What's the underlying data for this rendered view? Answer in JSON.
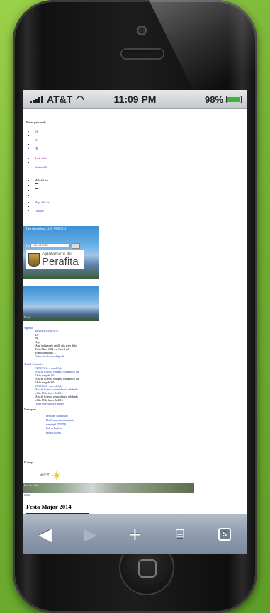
{
  "status": {
    "carrier": "AT&T",
    "time": "11:09 PM",
    "battery": "98%"
  },
  "page": {
    "title": "Eines personals",
    "lang_links": [
      "ES",
      "EN",
      "FR"
    ],
    "accessibility_link": "Accés mòbil",
    "full_view_link": "Vista mòbil",
    "size_label": "Mida del text",
    "sitemap_link": "Mapa del Lloc",
    "contact_link": "Contacte",
    "update_text": "Data i hora refresc: 22:07 / 09/08/2014",
    "search_label": "Cercar",
    "search_placeholder": "Cerca en el lloc",
    "logo_small": "Ajuntament de",
    "logo_big": "Perafita",
    "banner2_text": "Portal",
    "agenda_title": "Agenda",
    "agenda_lines": [
      "FESTA MAJOR 2014",
      "DV",
      "08",
      "Ago",
      "Aquí trobareu els detalls dels actes de la",
      "Festa Major 2014 a al Cartell del",
      "Esmorzament del ...",
      "Veure tots els actes d'agenda"
    ],
    "board_title": "Taulell d'anuncis",
    "board_lines": [
      "18/08/2014 - Actes del ple",
      "Acta de la sessió ordinària celebrada el dia",
      "18 de maig de 2014",
      "Acta de la sessió ordinària celebrada el dia",
      "18 de maig de 2014",
      "09/08/2014 - Actes del ple",
      "Acta de la sessió extraordinària celebrada",
      "el dia 18 de febrer de 2014",
      "Acta de la sessió extraordinària celebrada",
      "el dia 18 de febrer de 2014",
      "Veure tot el taulell d'anuncis"
    ],
    "featured_title": "Destaquem",
    "featured_items": [
      "Perfil del Contractant",
      "Pla d'ordenament urbanístic",
      "municipal (POUM)",
      "Pull de Perafita",
      "Pessics i lleres"
    ],
    "weather_title": "El temps",
    "weather_temp": "cel 17-27",
    "street_text": "Lloc de visitar",
    "street_sub": "2014",
    "festa_title": "Festa Major 2014"
  },
  "toolbar": {
    "back_icon": "back-arrow-icon",
    "forward_icon": "forward-arrow-icon",
    "add_icon": "plus-icon",
    "bookmarks_icon": "book-icon",
    "tabs_count": "5"
  }
}
